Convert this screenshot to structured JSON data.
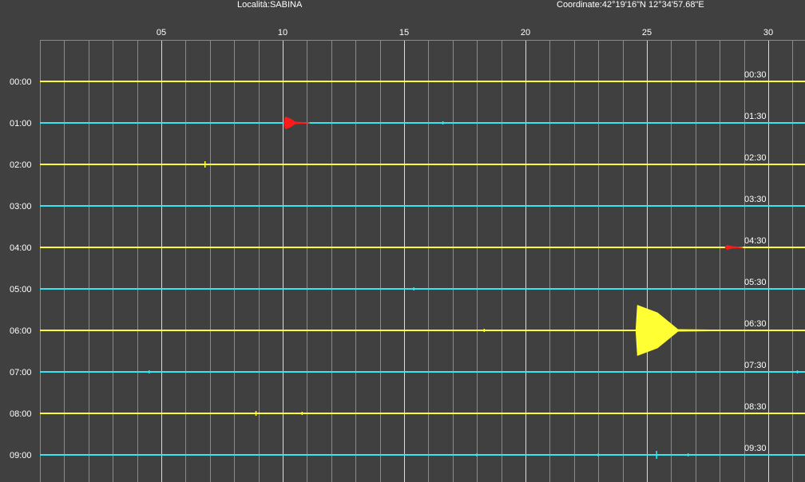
{
  "header": {
    "location": "Località:SABINA",
    "coordinates": "Coordinate:42°19'16\"N  12°34'57.68\"E"
  },
  "colors": {
    "background": "#404040",
    "grid": "#8a8a8a",
    "grid_major": "#dcdcdc",
    "trace_yellow": "#ffff33",
    "trace_cyan": "#33e6f0",
    "event": "#ff1a1a",
    "text": "#ffffff"
  },
  "chart_data": {
    "type": "line",
    "x_range": [
      0,
      31.5
    ],
    "x_unit": "minutes",
    "x_ticks": [
      {
        "value": 5,
        "label": "05"
      },
      {
        "value": 10,
        "label": "10"
      },
      {
        "value": 15,
        "label": "15"
      },
      {
        "value": 20,
        "label": "20"
      },
      {
        "value": 25,
        "label": "25"
      },
      {
        "value": 30,
        "label": "30"
      }
    ],
    "minor_tick_step": 1,
    "traces": [
      {
        "start_label": "00:00",
        "end_label": "00:30",
        "color": "yellow",
        "events": []
      },
      {
        "start_label": "01:00",
        "end_label": "01:30",
        "color": "cyan",
        "events": [
          {
            "minute": 10.1,
            "amplitude": 8,
            "color": "red"
          },
          {
            "minute": 16.6,
            "amplitude": 2,
            "color": "cyan"
          }
        ]
      },
      {
        "start_label": "02:00",
        "end_label": "02:30",
        "color": "yellow",
        "events": [
          {
            "minute": 6.8,
            "amplitude": 4,
            "color": "yellow"
          }
        ]
      },
      {
        "start_label": "03:00",
        "end_label": "03:30",
        "color": "cyan",
        "events": []
      },
      {
        "start_label": "04:00",
        "end_label": "04:30",
        "color": "yellow",
        "events": [
          {
            "minute": 28.3,
            "amplitude": 3,
            "color": "red"
          }
        ]
      },
      {
        "start_label": "05:00",
        "end_label": "05:30",
        "color": "cyan",
        "events": [
          {
            "minute": 15.4,
            "amplitude": 2,
            "color": "cyan"
          }
        ]
      },
      {
        "start_label": "06:00",
        "end_label": "06:30",
        "color": "yellow",
        "events": [
          {
            "minute": 18.3,
            "amplitude": 2,
            "color": "yellow"
          },
          {
            "minute": 24.6,
            "amplitude": 32,
            "color": "yellow"
          }
        ]
      },
      {
        "start_label": "07:00",
        "end_label": "07:30",
        "color": "cyan",
        "events": [
          {
            "minute": 4.5,
            "amplitude": 2,
            "color": "cyan"
          },
          {
            "minute": 31.2,
            "amplitude": 2,
            "color": "cyan"
          }
        ]
      },
      {
        "start_label": "08:00",
        "end_label": "08:30",
        "color": "yellow",
        "events": [
          {
            "minute": 8.9,
            "amplitude": 3,
            "color": "yellow"
          },
          {
            "minute": 10.8,
            "amplitude": 2,
            "color": "yellow"
          }
        ]
      },
      {
        "start_label": "09:00",
        "end_label": "09:30",
        "color": "cyan",
        "events": [
          {
            "minute": 18.0,
            "amplitude": 2,
            "color": "cyan"
          },
          {
            "minute": 23.0,
            "amplitude": 2,
            "color": "cyan"
          },
          {
            "minute": 25.4,
            "amplitude": 5,
            "color": "cyan"
          },
          {
            "minute": 26.7,
            "amplitude": 2,
            "color": "cyan"
          }
        ]
      }
    ]
  }
}
